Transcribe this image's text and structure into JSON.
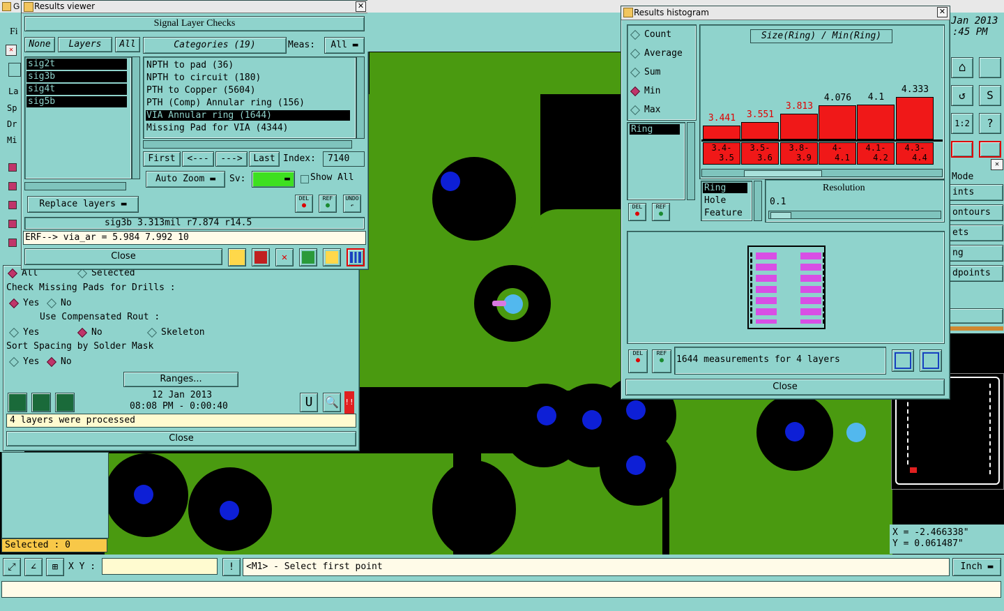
{
  "main_window": {
    "title_fragment": "G",
    "menu_fragment": "Fi",
    "side_fragments": [
      "La",
      "Sp",
      "Dr",
      "Mi"
    ],
    "date_fragment": "Jan 2013",
    "time_fragment": ":45 PM",
    "selected_label": "Selected : 0",
    "xy_label": "X Y :",
    "xy_value": "",
    "hint": "<M1> - Select first point",
    "units": "Inch",
    "coord_x": "X = -2.466338\"",
    "coord_y": "Y = 0.061487\"",
    "right_list": [
      "Mode",
      "ints",
      "ontours",
      "ets",
      "ng",
      "dpoints"
    ]
  },
  "analysis_panel": {
    "radio_all": "All",
    "radio_selected": "Selected",
    "missing_pads_label": "Check Missing Pads for Drills :",
    "missing_yes": "Yes",
    "missing_no": "No",
    "comp_rout_label": "Use Compensated Rout :",
    "comp_yes": "Yes",
    "comp_no": "No",
    "comp_skeleton": "Skeleton",
    "sort_label": "Sort Spacing by Solder Mask",
    "sort_yes": "Yes",
    "sort_no": "No",
    "ranges_button": "Ranges...",
    "date": "12 Jan 2013",
    "time": "08:08 PM - 0:00:40",
    "status": "4 layers were processed",
    "close": "Close"
  },
  "results_viewer": {
    "title": "Results viewer",
    "header": "Signal Layer Checks",
    "none_button": "None",
    "layers_button": "Layers",
    "all_button": "All",
    "layers": [
      "sig2t",
      "sig3b",
      "sig4t",
      "sig5b"
    ],
    "categories_button": "Categories (19)",
    "meas_label": "Meas:",
    "meas_value": "All",
    "categories": [
      "NPTH to pad (36)",
      "NPTH to circuit (180)",
      "PTH to Copper (5604)",
      "PTH (Comp) Annular ring (156)",
      "VIA Annular ring (1644)",
      "Missing Pad for VIA (4344)"
    ],
    "selected_category_index": 4,
    "first": "First",
    "prev": "<---",
    "next": "--->",
    "last": "Last",
    "index_label": "Index:",
    "index_value": "7140",
    "auto_zoom": "Auto Zoom",
    "sv_label": "Sv:",
    "show_all": "Show All",
    "replace_layers": "Replace layers",
    "del": "DEL",
    "ref": "REF",
    "undo": "UNDO",
    "info": "sig3b 3.313mil   r7.874  r14.5",
    "erf": "ERF--> via_ar = 5.984 7.992 10",
    "close": "Close",
    "colors": {
      "sv_green": "#3ee020"
    }
  },
  "histogram": {
    "title": "Results histogram",
    "modes": [
      "Count",
      "Average",
      "Sum",
      "Min",
      "Max"
    ],
    "selected_mode": "Min",
    "left_list": [
      "Ring"
    ],
    "chart_title": "Size(Ring) / Min(Ring)",
    "bars": [
      {
        "range": "3.4-3.5",
        "value": 3.441,
        "label": "3.441"
      },
      {
        "range": "3.5-3.6",
        "value": 3.551,
        "label": "3.551"
      },
      {
        "range": "3.8-3.9",
        "value": 3.813,
        "label": "3.813"
      },
      {
        "range": "4-4.1",
        "value": 4.076,
        "label": "4.076"
      },
      {
        "range": "4.1-4.2",
        "value": 4.1,
        "label": "4.1"
      },
      {
        "range": "4.3-4.4",
        "value": 4.333,
        "label": "4.333"
      }
    ],
    "range_lines": [
      [
        "3.4-",
        "3.5"
      ],
      [
        "3.5-",
        "3.6"
      ],
      [
        "3.8-",
        "3.9"
      ],
      [
        "4-",
        "4.1"
      ],
      [
        "4.1-",
        "4.2"
      ],
      [
        "4.3-",
        "4.4"
      ]
    ],
    "feature_list": [
      "Ring",
      "Hole",
      "Feature"
    ],
    "resolution_label": "Resolution",
    "resolution_value": "0.1",
    "measurements": "1644 measurements for 4 layers",
    "del": "DEL",
    "ref": "REF",
    "close": "Close",
    "colors": {
      "bar": "#f01818",
      "label_red": "#e00000"
    }
  }
}
